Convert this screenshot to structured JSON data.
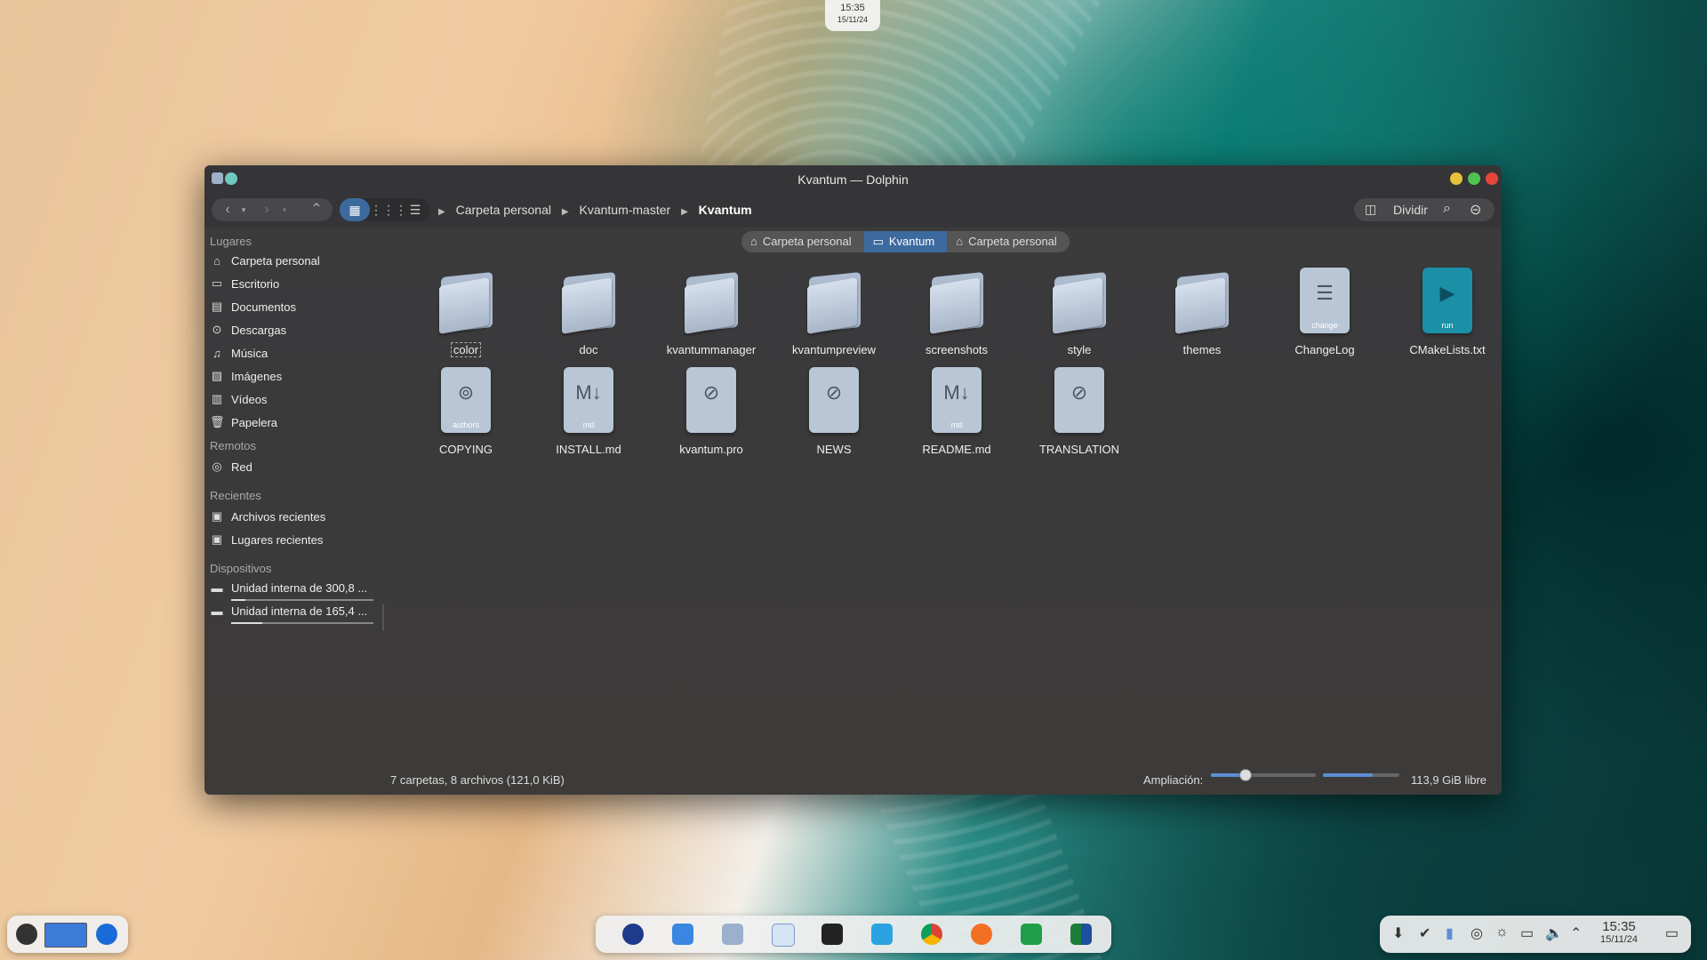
{
  "desktop": {
    "top_clock": {
      "time": "15:35",
      "date": "15/11/24"
    }
  },
  "window": {
    "title": "Kvantum — Dolphin",
    "breadcrumb": [
      "Carpeta personal",
      "Kvantum-master",
      "Kvantum"
    ],
    "split_label": "Dividir",
    "tabs": [
      {
        "label": "Carpeta personal",
        "icon": "home-icon"
      },
      {
        "label": "Kvantum",
        "icon": "folder-icon"
      },
      {
        "label": "Carpeta personal",
        "icon": "home-icon"
      }
    ],
    "sidebar": {
      "places_header": "Lugares",
      "places": [
        "Carpeta personal",
        "Escritorio",
        "Documentos",
        "Descargas",
        "Música",
        "Imágenes",
        "Vídeos",
        "Papelera"
      ],
      "remote_header": "Remotos",
      "remote": [
        "Red"
      ],
      "recent_header": "Recientes",
      "recent": [
        "Archivos recientes",
        "Lugares recientes"
      ],
      "devices_header": "Dispositivos",
      "devices": [
        {
          "label": "Unidad interna de 300,8 ...",
          "usage": 0.1
        },
        {
          "label": "Unidad interna de 165,4 ...",
          "usage": 0.22
        }
      ]
    },
    "files": [
      {
        "name": "color",
        "kind": "folder"
      },
      {
        "name": "doc",
        "kind": "folder"
      },
      {
        "name": "kvantummanager",
        "kind": "folder"
      },
      {
        "name": "kvantumpreview",
        "kind": "folder"
      },
      {
        "name": "screenshots",
        "kind": "folder"
      },
      {
        "name": "style",
        "kind": "folder"
      },
      {
        "name": "themes",
        "kind": "folder"
      },
      {
        "name": "ChangeLog",
        "kind": "file",
        "tag": "change"
      },
      {
        "name": "CMakeLists.txt",
        "kind": "file",
        "tag": "run"
      },
      {
        "name": "COPYING",
        "kind": "file",
        "tag": "authors"
      },
      {
        "name": "INSTALL.md",
        "kind": "file",
        "tag": "md"
      },
      {
        "name": "kvantum.pro",
        "kind": "file",
        "tag": ""
      },
      {
        "name": "NEWS",
        "kind": "file",
        "tag": ""
      },
      {
        "name": "README.md",
        "kind": "file",
        "tag": "md"
      },
      {
        "name": "TRANSLATION",
        "kind": "file",
        "tag": ""
      }
    ],
    "status": {
      "summary": "7 carpetas, 8 archivos (121,0 KiB)",
      "zoom_label": "Ampliación:",
      "zoom_level": 0.32,
      "free_space": "113,9 GiB libre",
      "disk_used": 0.65
    }
  },
  "tray": {
    "time": "15:35",
    "date": "15/11/24"
  },
  "colors": {
    "accent": "#3d6a9e",
    "window_bg": "#3a3a3b"
  }
}
